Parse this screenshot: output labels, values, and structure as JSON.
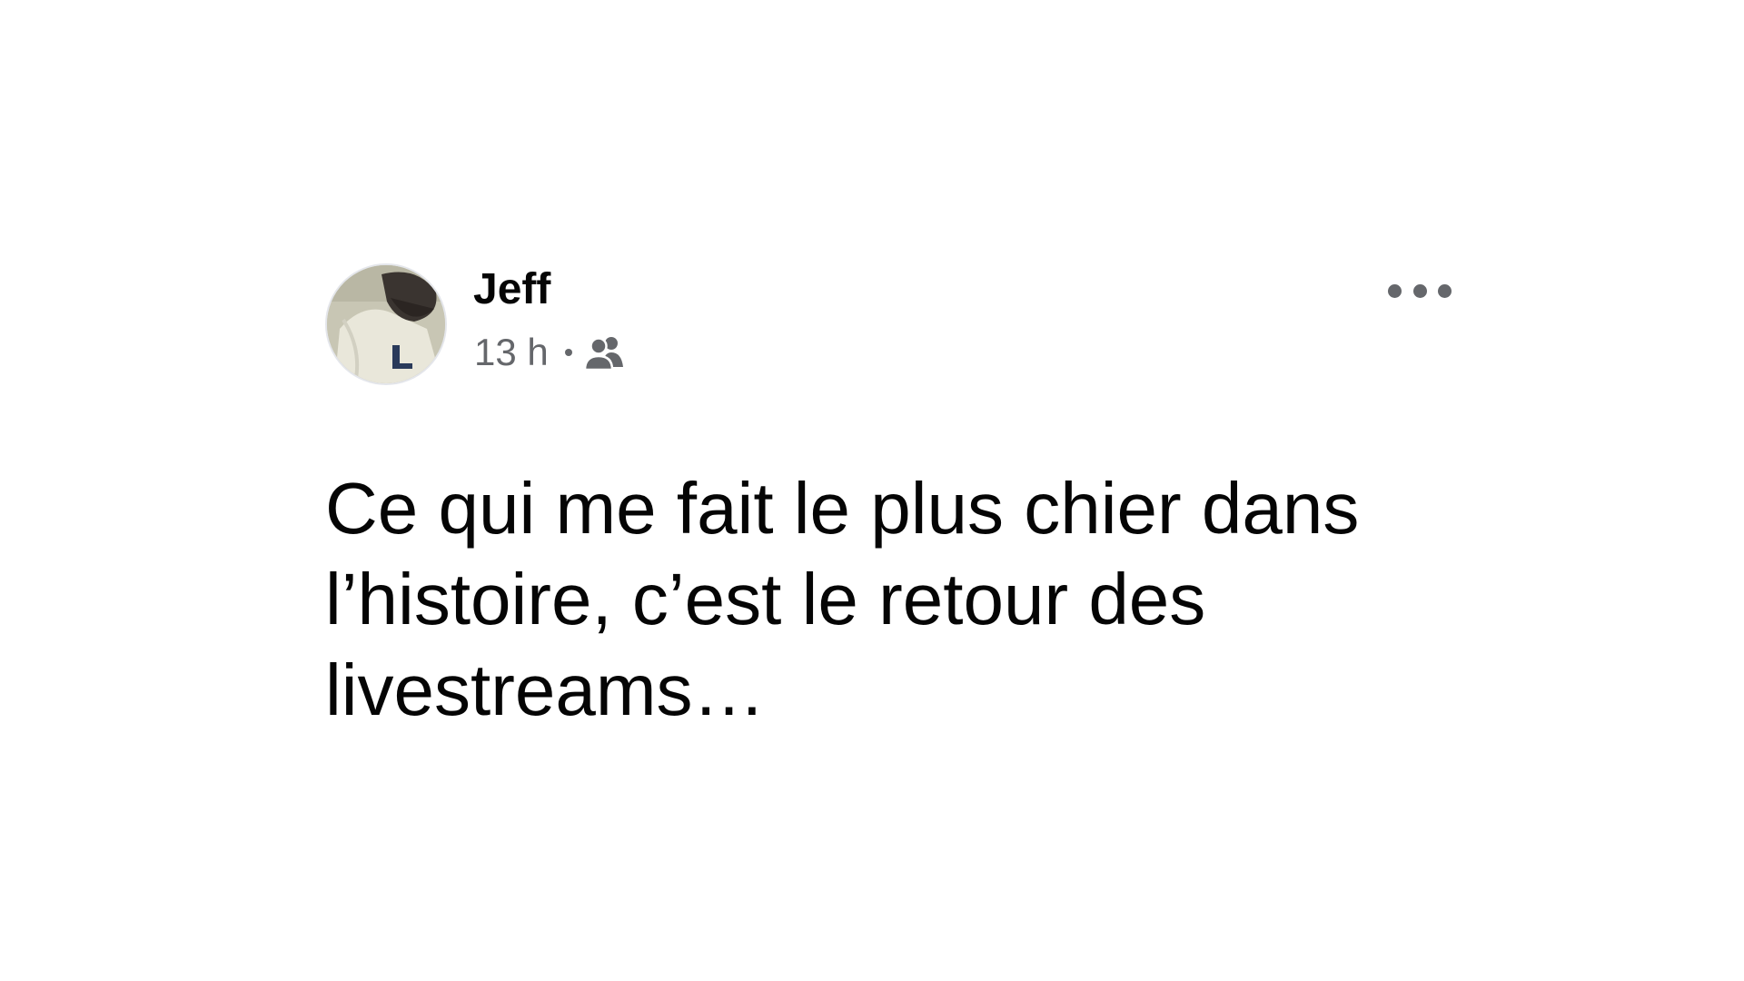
{
  "post": {
    "author": {
      "name": "Jeff",
      "avatar_icon": "profile-photo"
    },
    "meta": {
      "time": "13 h",
      "audience_icon": "friends-icon"
    },
    "more_icon": "more-options-icon",
    "text": "Ce qui me fait le plus chier dans\nl’histoire, c’est le retour des\nlivestreams…"
  },
  "colors": {
    "background": "#ffffff",
    "primary_text": "#050505",
    "secondary_text": "#65676b"
  }
}
